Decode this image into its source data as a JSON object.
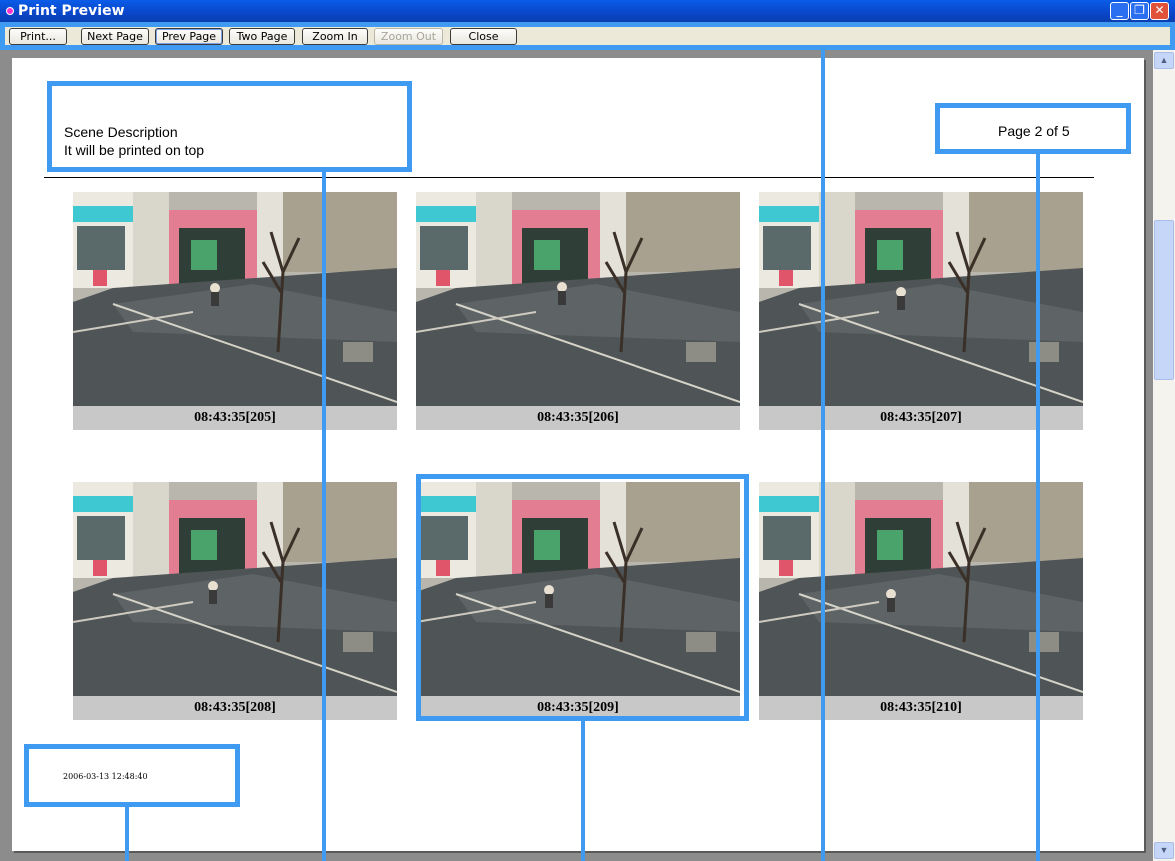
{
  "window": {
    "title": "Print Preview",
    "controls": {
      "minimize": "_",
      "maximize": "❐",
      "close": "✕"
    }
  },
  "toolbar": {
    "buttons": [
      {
        "label": "Print...",
        "enabled": true
      },
      {
        "label": "Next Page",
        "enabled": true
      },
      {
        "label": "Prev Page",
        "enabled": true
      },
      {
        "label": "Two Page",
        "enabled": true
      },
      {
        "label": "Zoom In",
        "enabled": true
      },
      {
        "label": "Zoom Out",
        "enabled": false
      },
      {
        "label": "Close",
        "enabled": true
      }
    ]
  },
  "page": {
    "scene_description_line1": "Scene Description",
    "scene_description_line2": "It will be printed on top",
    "page_indicator": "Page 2 of 5",
    "print_date": "2006-03-13 12:48:40",
    "thumbnails": [
      {
        "caption": "08:43:35[205]"
      },
      {
        "caption": "08:43:35[206]"
      },
      {
        "caption": "08:43:35[207]"
      },
      {
        "caption": "08:43:35[208]"
      },
      {
        "caption": "08:43:35[209]"
      },
      {
        "caption": "08:43:35[210]"
      }
    ]
  },
  "scrollbar": {
    "up_arrow": "▲",
    "down_arrow": "▼"
  },
  "colors": {
    "callout": "#3f9bf2",
    "titlebar": "#0a46c8",
    "caption_bg": "#c8c8c8"
  }
}
